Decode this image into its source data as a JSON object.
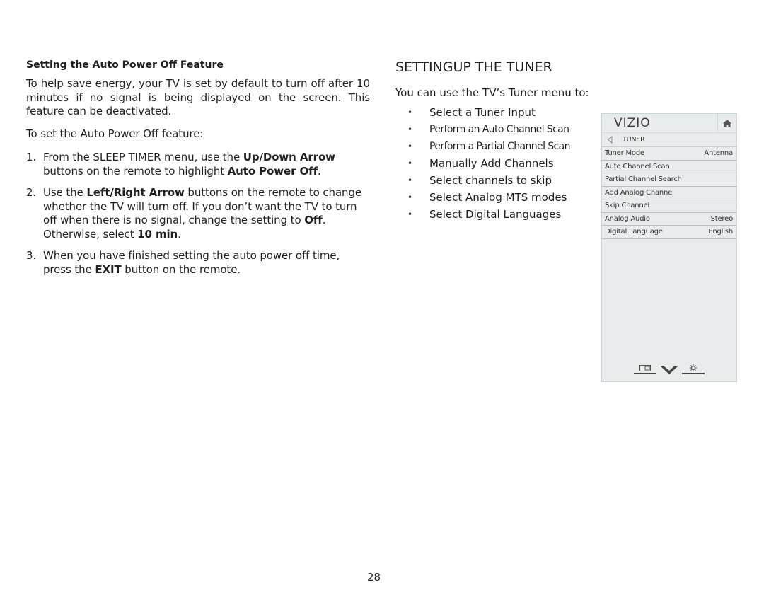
{
  "left": {
    "subheading": "Setting the Auto Power Off Feature",
    "intro": "To help save energy, your TV is set by default to turn off after 10 minutes if no signal is being displayed on the screen. This feature can be deactivated.",
    "lead": "To set the Auto Power Off feature:",
    "steps": [
      {
        "num": "1.",
        "parts": [
          "From the SLEEP TIMER menu, use the ",
          "Up/Down Arrow",
          " buttons on the remote to highlight ",
          "Auto Power Off",
          "."
        ]
      },
      {
        "num": "2.",
        "parts": [
          "Use the ",
          "Left/Right Arrow",
          "  buttons on the remote to change whether the TV will turn off. If you don’t want the TV to turn off when there is no signal, change the setting to ",
          "Off",
          ". Otherwise, select ",
          "10 min",
          "."
        ]
      },
      {
        "num": "3.",
        "parts": [
          "When you have finished setting the auto power off time, press the ",
          "EXIT",
          " button on the remote."
        ]
      }
    ]
  },
  "right": {
    "title": "SETTINGUP THE TUNER",
    "intro": "You can use the TV’s Tuner menu to:",
    "bullet_glyph": "•",
    "bullets": [
      "Select a Tuner Input",
      "Perform an Auto Channel Scan",
      "Perform a Partial Channel Scan",
      "Manually Add Channels",
      "Select channels to skip",
      "Select Analog MTS modes",
      "Select Digital Languages"
    ]
  },
  "tv_menu": {
    "logo": "VIZIO",
    "breadcrumb": "TUNER",
    "rows": [
      {
        "label": "Tuner Mode",
        "value": "Antenna"
      },
      {
        "label": "Auto Channel Scan",
        "value": ""
      },
      {
        "label": "Partial Channel Search",
        "value": ""
      },
      {
        "label": "Add Analog Channel",
        "value": ""
      },
      {
        "label": "Skip Channel",
        "value": ""
      },
      {
        "label": "Analog Audio",
        "value": "Stereo"
      },
      {
        "label": "Digital Language",
        "value": "English"
      }
    ],
    "footer_icons": [
      "wide-icon",
      "vizio-v-icon",
      "settings-icon"
    ]
  },
  "page_number": "28"
}
